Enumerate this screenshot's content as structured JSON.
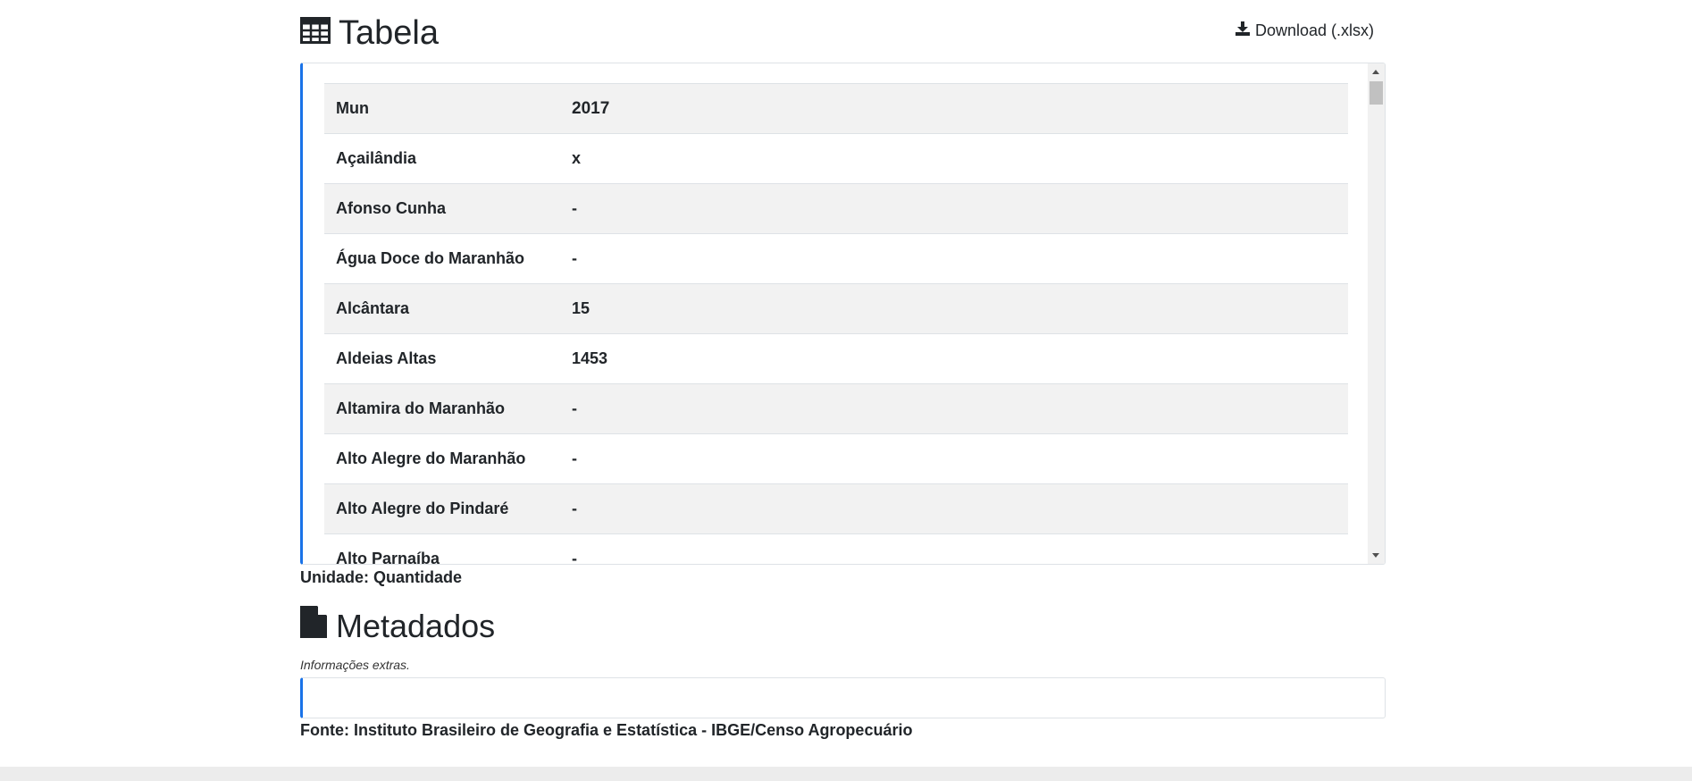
{
  "table_section": {
    "title": "Tabela",
    "download_label": "Download (.xlsx)",
    "header": {
      "col1": "Mun",
      "col2": "2017"
    },
    "rows": [
      {
        "mun": "Açailândia",
        "value": "x"
      },
      {
        "mun": "Afonso Cunha",
        "value": "-"
      },
      {
        "mun": "Água Doce do Maranhão",
        "value": "-"
      },
      {
        "mun": "Alcântara",
        "value": "15"
      },
      {
        "mun": "Aldeias Altas",
        "value": "1453"
      },
      {
        "mun": "Altamira do Maranhão",
        "value": "-"
      },
      {
        "mun": "Alto Alegre do Maranhão",
        "value": "-"
      },
      {
        "mun": "Alto Alegre do Pindaré",
        "value": "-"
      },
      {
        "mun": "Alto Parnaíba",
        "value": "-"
      }
    ],
    "unit": "Unidade: Quantidade"
  },
  "metadata_section": {
    "title": "Metadados",
    "extras_label": "Informações extras.",
    "source": "Fonte: Instituto Brasileiro de Geografia e Estatística - IBGE/Censo Agropecuário"
  },
  "colors": {
    "accent": "#1a73e8",
    "stripe": "#f2f2f2",
    "border": "#dee2e6",
    "text": "#212529"
  }
}
